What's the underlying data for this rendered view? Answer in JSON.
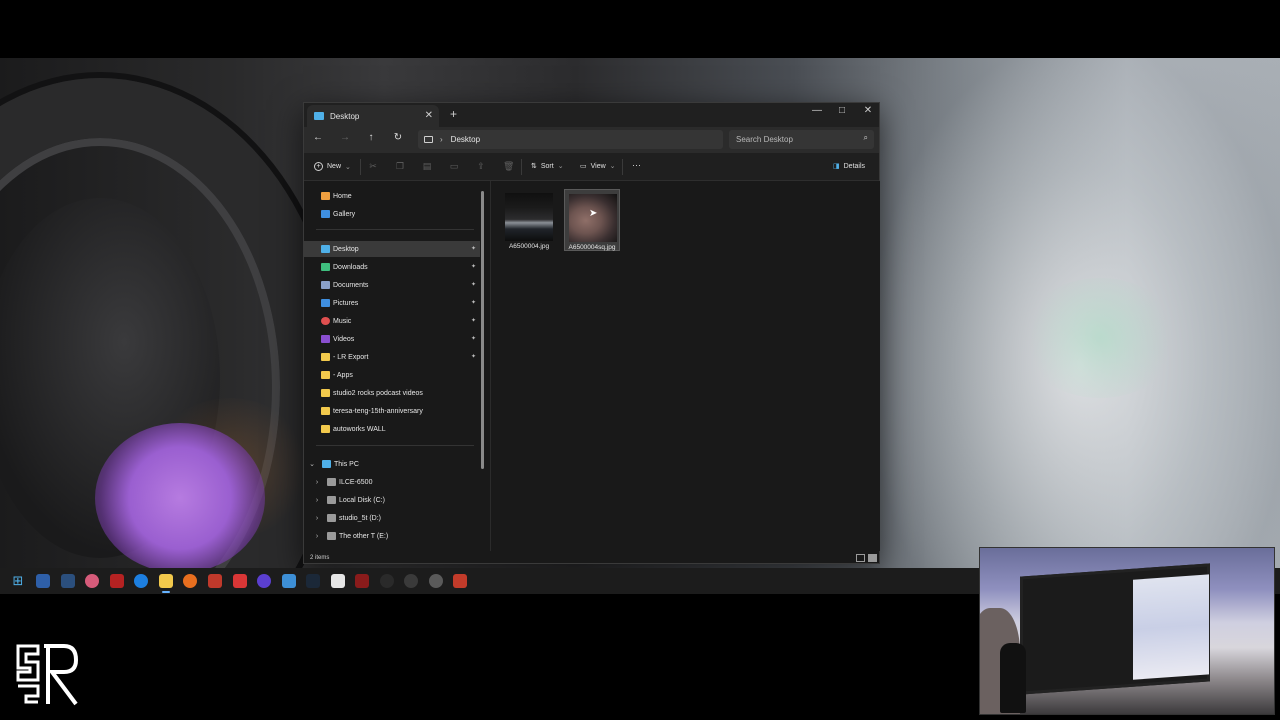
{
  "window": {
    "tab_title": "Desktop",
    "new_tab": "+",
    "tab_close": "✕",
    "minimize": "—",
    "maximize": "□",
    "close": "✕"
  },
  "nav": {
    "back": "←",
    "forward": "→",
    "up": "↑",
    "refresh": "↻",
    "breadcrumb_sep": "›",
    "location": "Desktop",
    "search_placeholder": "Search Desktop",
    "search_icon": "⌕"
  },
  "toolbar": {
    "new_label": "New",
    "sort_label": "Sort",
    "view_label": "View",
    "more_label": "···",
    "details_label": "Details",
    "dropdown_glyph": "⌄"
  },
  "sidebar": {
    "items": [
      {
        "label": "Home",
        "icon": "home-icon",
        "color": "#f0a040"
      },
      {
        "label": "Gallery",
        "icon": "gallery-icon",
        "color": "#3f8fe0"
      },
      {
        "label": "Desktop",
        "icon": "desktop-icon",
        "color": "#4fb0e8",
        "pinned": true,
        "selected": true
      },
      {
        "label": "Downloads",
        "icon": "download-icon",
        "color": "#3fbf7f",
        "pinned": true
      },
      {
        "label": "Documents",
        "icon": "documents-icon",
        "color": "#8aa0c8",
        "pinned": true
      },
      {
        "label": "Pictures",
        "icon": "pictures-icon",
        "color": "#3f8fe0",
        "pinned": true
      },
      {
        "label": "Music",
        "icon": "music-icon",
        "color": "#e05050",
        "pinned": true
      },
      {
        "label": "Videos",
        "icon": "videos-icon",
        "color": "#8a4fd0",
        "pinned": true
      },
      {
        "label": "- LR Export",
        "icon": "folder-icon",
        "color": "#f2c94c",
        "pinned": true
      },
      {
        "label": "- Apps",
        "icon": "folder-icon",
        "color": "#f2c94c"
      },
      {
        "label": "studio2 rocks podcast videos",
        "icon": "folder-icon",
        "color": "#f2c94c"
      },
      {
        "label": "teresa-teng-15th-anniversary",
        "icon": "folder-icon",
        "color": "#f2c94c"
      },
      {
        "label": "autoworks WALL",
        "icon": "folder-icon",
        "color": "#f2c94c"
      }
    ],
    "this_pc": {
      "label": "This PC",
      "expand": "⌄"
    },
    "drives": [
      {
        "label": "ILCE-6500"
      },
      {
        "label": "Local Disk (C:)"
      },
      {
        "label": "studio_5t (D:)"
      },
      {
        "label": "The other T (E:)"
      }
    ],
    "pin_glyph": "✦",
    "collapsed_glyph": "›"
  },
  "files": [
    {
      "name": "A6500004.jpg",
      "selected": false
    },
    {
      "name": "A6500004sq.jpg",
      "selected": true
    }
  ],
  "status": {
    "item_count": "2 items"
  },
  "colors": {
    "accent": "#4fb0e8",
    "window_bg": "#191919",
    "selected_bg": "#3a3a3a"
  }
}
